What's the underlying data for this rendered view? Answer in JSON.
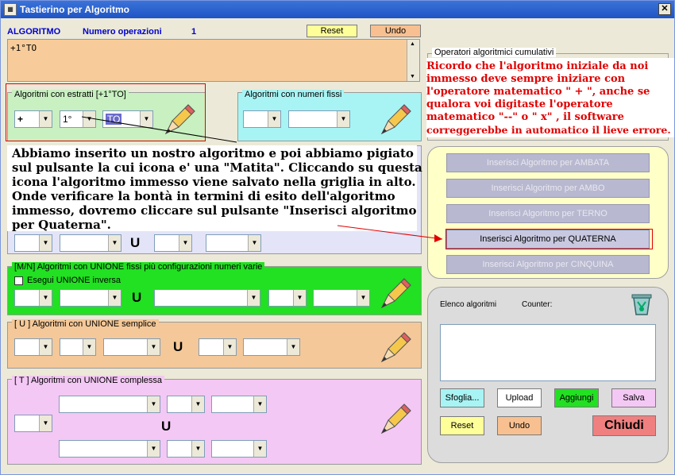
{
  "window": {
    "title": "Tastierino per Algoritmo",
    "icon": "app-icon"
  },
  "header": {
    "algoritmo_label": "ALGORITMO",
    "num_operazioni_label": "Numero operazioni",
    "num_operazioni_value": "1",
    "reset_label": "Reset",
    "undo_label": "Undo"
  },
  "algorithm_text": "+1°TO",
  "estratti": {
    "legend": "Algoritmi con estratti  [+1°TO]",
    "op": "+",
    "pos": "1°",
    "wheel": "TO"
  },
  "fissi": {
    "legend": "Algoritmi con numeri fissi"
  },
  "mn": {
    "legend": "[M/N] Algoritmi con UNIONE fissi più configurazioni numeri varie",
    "checkbox_label": "Esegui UNIONE inversa",
    "u": "U"
  },
  "partial_u": "U",
  "u_simple": {
    "legend": "[ U ] Algoritmi con UNIONE semplice",
    "u": "U"
  },
  "t_complex": {
    "legend": "[ T ] Algoritmi con UNIONE complessa",
    "u": "U"
  },
  "cumulativi": {
    "legend": "Operatori algoritmici cumulativi"
  },
  "insert_buttons": [
    "Inserisci Algoritmo per AMBATA",
    "Inserisci Algoritmo per AMBO",
    "Inserisci Algoritmo per TERNO",
    "Inserisci Algoritmo per QUATERNA",
    "Inserisci Algoritmo per CINQUINA"
  ],
  "elenco": {
    "label": "Elenco algoritmi",
    "counter_label": "Counter:",
    "sfoglia": "Sfoglia...",
    "upload": "Upload",
    "aggiungi": "Aggiungi",
    "salva": "Salva",
    "reset": "Reset",
    "undo": "Undo",
    "chiudi": "Chiudi"
  },
  "annotations": {
    "red_note": [
      "Ricordo che l'algoritmo iniziale da noi",
      "immesso deve sempre iniziare con",
      "l'operatore matematico  \" + \", anche se",
      "qualora voi digitaste l'operatore",
      "matematico \"--\" o \" x\" , il software",
      "correggerebbe in automatico il lieve errore."
    ],
    "black_note": [
      "Abbiamo inserito un nostro algoritmo e poi abbiamo pigiato",
      "sul pulsante la cui icona e' una \"Matita\". Cliccando su questa",
      "icona l'algoritmo immesso viene salvato nella griglia in alto.",
      "Onde verificare la bontà in termini di esito dell'algoritmo",
      "immesso, dovremo cliccare sul pulsante \"Inserisci algoritmo",
      "per Quaterna\"."
    ]
  },
  "colors": {
    "accent_blue": "#0000cc",
    "algorithm_box": "#f8cc9a",
    "estratti_bg": "#c8f0c0",
    "fissi_bg": "#a8f4f4",
    "mn_bg": "#22e022",
    "u_simple_bg": "#f4c898",
    "t_complex_bg": "#f4c8f4",
    "insert_panel_bg": "#ffffc8",
    "red_note": "#e00000"
  }
}
